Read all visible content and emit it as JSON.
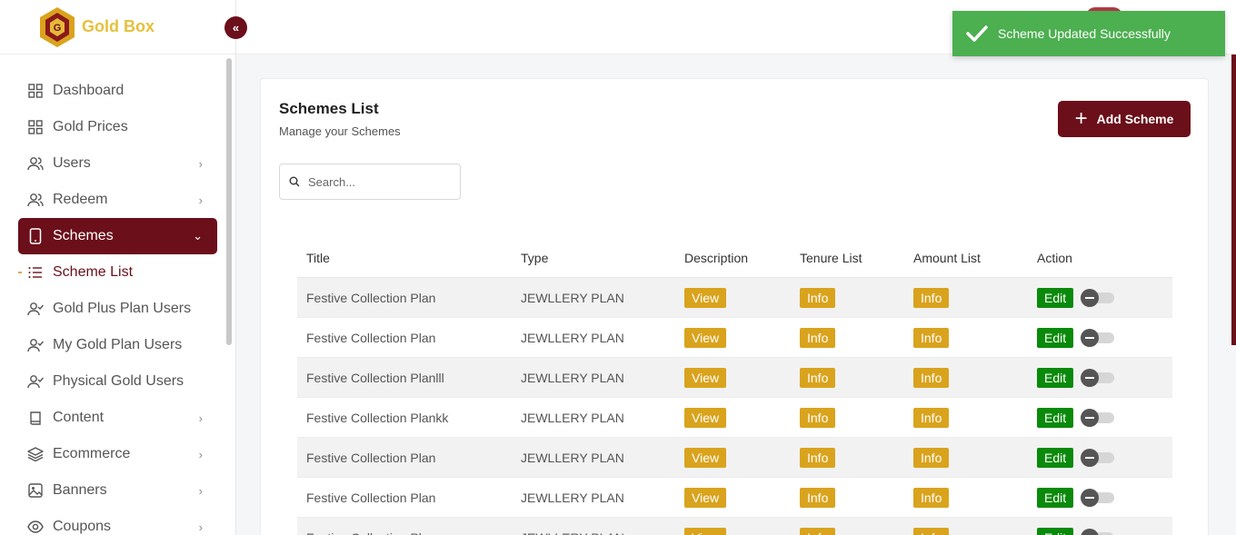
{
  "brand": {
    "name": "Gold Box"
  },
  "sidebar": {
    "items": [
      {
        "label": "Dashboard",
        "icon": "grid-icon",
        "chevron": false
      },
      {
        "label": "Gold Prices",
        "icon": "grid-icon",
        "chevron": false
      },
      {
        "label": "Users",
        "icon": "users-icon",
        "chevron": true
      },
      {
        "label": "Redeem",
        "icon": "users-icon",
        "chevron": true
      },
      {
        "label": "Schemes",
        "icon": "tablet-icon",
        "chevron": true,
        "active": true
      },
      {
        "label": "Scheme List",
        "icon": "list-icon",
        "chevron": false,
        "sub": true
      },
      {
        "label": "Gold Plus Plan Users",
        "icon": "user-check-icon",
        "chevron": false
      },
      {
        "label": "My Gold Plan Users",
        "icon": "user-check-icon",
        "chevron": false
      },
      {
        "label": "Physical Gold Users",
        "icon": "user-check-icon",
        "chevron": false
      },
      {
        "label": "Content",
        "icon": "book-icon",
        "chevron": true
      },
      {
        "label": "Ecommerce",
        "icon": "layers-icon",
        "chevron": true
      },
      {
        "label": "Banners",
        "icon": "image-icon",
        "chevron": true
      },
      {
        "label": "Coupons",
        "icon": "eye-icon",
        "chevron": true
      }
    ]
  },
  "toast": {
    "message": "Scheme Updated Successfully"
  },
  "card": {
    "title": "Schemes List",
    "subtitle": "Manage your Schemes",
    "add_label": "Add Scheme",
    "search_placeholder": "Search..."
  },
  "table": {
    "headers": [
      "Title",
      "Type",
      "Description",
      "Tenure List",
      "Amount List",
      "Action"
    ],
    "view_label": "View",
    "info_label": "Info",
    "edit_label": "Edit",
    "rows": [
      {
        "title": "Festive Collection Plan",
        "type": "JEWLLERY PLAN"
      },
      {
        "title": "Festive Collection Plan",
        "type": "JEWLLERY PLAN"
      },
      {
        "title": "Festive Collection Planlll",
        "type": "JEWLLERY PLAN"
      },
      {
        "title": "Festive Collection Plankk",
        "type": "JEWLLERY PLAN"
      },
      {
        "title": "Festive Collection Plan",
        "type": "JEWLLERY PLAN"
      },
      {
        "title": "Festive Collection Plan",
        "type": "JEWLLERY PLAN"
      },
      {
        "title": "Festive Collection Pl...",
        "type": "JEWLLERY PLAN"
      }
    ]
  },
  "colors": {
    "primary": "#6b0f1a",
    "gold": "#d9a31d",
    "success": "#4caf50",
    "edit": "#0a8a0a"
  }
}
